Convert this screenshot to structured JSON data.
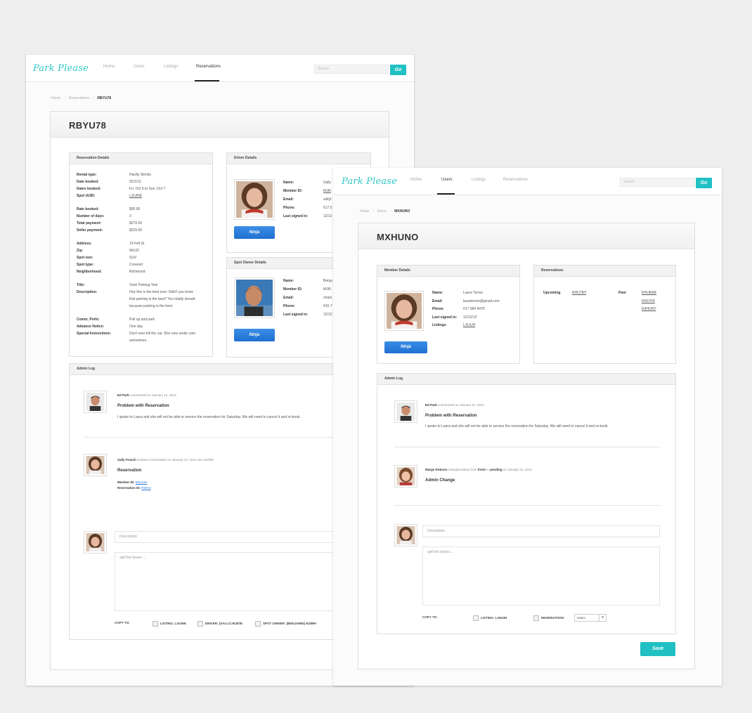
{
  "brand": "Park Please",
  "search": {
    "placeholder": "Search",
    "button": "Go"
  },
  "nav": [
    "Home",
    "Users",
    "Listings",
    "Reservations"
  ],
  "reservation_page": {
    "breadcrumb": [
      "Home",
      "Reservations",
      "RBYU78"
    ],
    "title": "RBYU78",
    "reservation_details": {
      "heading": "Reservation Details",
      "group1": [
        {
          "k": "Rental type:",
          "v": "Hardly Strictly"
        },
        {
          "k": "Date booked:",
          "v": "9/21/12"
        },
        {
          "k": "Dates booked:",
          "v": "Fri, Oct 5 to Sun, Oct 7"
        },
        {
          "k": "Spot UUID:",
          "v": "LXUINK"
        }
      ],
      "group2": [
        {
          "k": "Rate booked:",
          "v": "$90.00"
        },
        {
          "k": "Number of days:",
          "v": "3"
        },
        {
          "k": "Total payment:",
          "v": "$270.00"
        },
        {
          "k": "Seller payment:",
          "v": "$225.00"
        }
      ],
      "group3": [
        {
          "k": "Address:",
          "v": "19 Fell St"
        },
        {
          "k": "Zip:",
          "v": "94122"
        },
        {
          "k": "Spot size:",
          "v": "SUV"
        },
        {
          "k": "Spot type:",
          "v": "Covered"
        },
        {
          "k": "Neighborhood:",
          "v": "Richmond"
        }
      ],
      "title_k": "Title:",
      "title_v": "Yeah Parking Yea!",
      "desc_k": "Description:",
      "desc_lines": [
        "Hey this is the best ever. Didn't you know",
        "that parking is the best? You totally should",
        "because parking is the best."
      ],
      "group4": [
        {
          "k": "Comm_Prefs:",
          "v": "Pull up and park"
        },
        {
          "k": "Advance Notice:",
          "v": "One day"
        }
      ],
      "special_k": "Special Instructions:",
      "special_lines": [
        "Don't ever kill the cat. She runs under cars",
        "sometimes."
      ]
    },
    "driver_details": {
      "heading": "Driver Details",
      "rows": [
        {
          "k": "Name:",
          "v": "Sally"
        },
        {
          "k": "Member ID:",
          "v": "MJ8I"
        },
        {
          "k": "Email:",
          "v": "sallyf"
        },
        {
          "k": "Phone:",
          "v": "617 5"
        },
        {
          "k": "Last signed in:",
          "v": "12/12"
        }
      ],
      "button": "Ninja"
    },
    "owner_details": {
      "heading": "Spot Owner Details",
      "rows": [
        {
          "k": "Name:",
          "v": "Benja"
        },
        {
          "k": "Member ID:",
          "v": "MJ8I"
        },
        {
          "k": "Email:",
          "v": "chark"
        },
        {
          "k": "Phone:",
          "v": "415 7"
        },
        {
          "k": "Last signed in:",
          "v": "12/12"
        }
      ],
      "button": "Ninja"
    },
    "admin_log": {
      "heading": "Admin Log",
      "entry1": {
        "author": "Ed Park",
        "meta": "commented on January 12, 2012",
        "title": "Problem with Reservation",
        "body": "I spoke to Laura and she will not be able to service the reservation for Saturday. We will need to cancel it and re-book."
      },
      "entry2": {
        "author": "Sally Franch",
        "meta": "booked a reservation on January 12, 2012 via LXUINK",
        "title": "Reservation",
        "member_k": "Member ID:",
        "member_v": "MXHUN",
        "res_k": "Reservation ID:",
        "res_v": "RIIIHU"
      },
      "desc_placeholder": "Description",
      "body_placeholder": "spill the beans ...",
      "copy_to": "COPY TO:",
      "copy_opts": [
        "LISTING: LXUINK",
        "DRIVER: (SALLY) MJ87B",
        "SPOT OWNER: (BENJAMIN) MJ89H"
      ]
    }
  },
  "user_page": {
    "breadcrumb": [
      "Home",
      "Users",
      "MXHUNO"
    ],
    "title": "MXHUNO",
    "member_details": {
      "heading": "Member Details",
      "rows": [
        {
          "k": "Name:",
          "v": "Laura Torres"
        },
        {
          "k": "Email:",
          "v": "lauratorres@gmail.com"
        },
        {
          "k": "Phone:",
          "v": "617 584 4479"
        },
        {
          "k": "Last signed in:",
          "v": "12/12/12"
        },
        {
          "k": "Listings:",
          "v": "LXUIJH"
        }
      ],
      "button": "Ninja"
    },
    "reservations": {
      "heading": "Reservations",
      "upcoming_label": "Upcoming",
      "upcoming": [
        "RHU78H"
      ],
      "past_label": "Past",
      "past": [
        "RHUBAB",
        "R067HS",
        "R4HURY"
      ]
    },
    "admin_log": {
      "heading": "Admin Log",
      "entry1": {
        "author": "Ed Park",
        "meta": "commented on January 12, 2012",
        "title": "Problem with Reservation",
        "body": "I spoke to Laura and she will not be able to service the reservation for Saturday. We will need to cancel it and re-book."
      },
      "entry2": {
        "author": "Marge Doboon",
        "meta1": "changed status from",
        "from": "fresh",
        "to_word": "to",
        "to": "pending",
        "meta2": "on January 12, 2012",
        "title": "Admin Change"
      },
      "desc_placeholder": "Description",
      "body_placeholder": "spill the beans ...",
      "copy_to": "COPY TO:",
      "copy_opts": [
        "LISTING: LXHUIH",
        "RESERVATION:"
      ],
      "select_value": "select",
      "save": "Save"
    }
  }
}
